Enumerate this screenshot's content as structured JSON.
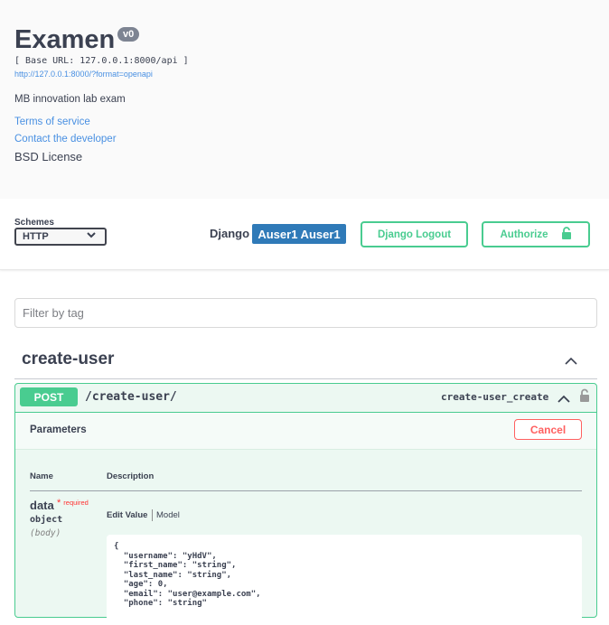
{
  "info": {
    "title": "Examen",
    "version": "v0",
    "base_url": "[ Base URL: 127.0.0.1:8000/api ]",
    "spec_link": "http://127.0.0.1:8000/?format=openapi",
    "description": "MB innovation lab exam",
    "terms_link": "Terms of service",
    "contact_link": "Contact the developer",
    "license": "BSD License"
  },
  "schemes": {
    "label": "Schemes",
    "selected": "HTTP"
  },
  "auth": {
    "django_label": "Django",
    "user": "Auser1 Auser1",
    "logout_label": "Django Logout",
    "authorize_label": "Authorize"
  },
  "filter": {
    "placeholder": "Filter by tag"
  },
  "tag": {
    "name": "create-user"
  },
  "operation": {
    "method": "POST",
    "path": "/create-user/",
    "operation_id": "create-user_create",
    "parameters_title": "Parameters",
    "cancel_label": "Cancel",
    "columns": {
      "name": "Name",
      "description": "Description"
    },
    "param": {
      "name": "data",
      "required": "required",
      "type": "object",
      "in": "(body)"
    },
    "tabs": {
      "edit": "Edit Value",
      "model": "Model"
    },
    "body_value": "{\n  \"username\": \"yHdV\",\n  \"first_name\": \"string\",\n  \"last_name\": \"string\",\n  \"age\": 0,\n  \"email\": \"user@example.com\",\n  \"phone\": \"string\""
  },
  "colors": {
    "post_green": "#49cc90",
    "link_blue": "#4990e2",
    "user_badge": "#2f7ab8",
    "cancel_red": "#ff6060"
  }
}
